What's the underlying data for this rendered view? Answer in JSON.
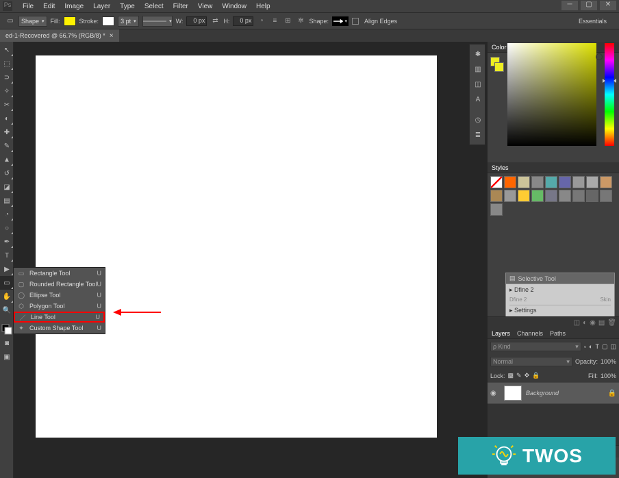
{
  "menubar": {
    "items": [
      "File",
      "Edit",
      "Image",
      "Layer",
      "Type",
      "Select",
      "Filter",
      "View",
      "Window",
      "Help"
    ]
  },
  "options": {
    "shape_mode": "Shape",
    "fill_label": "Fill:",
    "fill_color": "#fff200",
    "stroke_label": "Stroke:",
    "stroke_color": "#ffffff",
    "stroke_width": "3 pt",
    "w_label": "W:",
    "w_value": "0 px",
    "h_label": "H:",
    "h_value": "0 px",
    "shape_label": "Shape:",
    "align_label": "Align Edges",
    "workspace": "Essentials"
  },
  "tab": {
    "title": "ed-1-Recovered @ 66.7% (RGB/8) *"
  },
  "toolbar": {
    "tools": [
      {
        "name": "move-tool",
        "glyph": "↖"
      },
      {
        "name": "marquee-tool",
        "glyph": "▭"
      },
      {
        "name": "lasso-tool",
        "glyph": "⊃"
      },
      {
        "name": "magic-wand-tool",
        "glyph": "✦"
      },
      {
        "name": "crop-tool",
        "glyph": "✂"
      },
      {
        "name": "eyedropper-tool",
        "glyph": "◐"
      },
      {
        "name": "healing-tool",
        "glyph": "✚"
      },
      {
        "name": "brush-tool",
        "glyph": "✎"
      },
      {
        "name": "stamp-tool",
        "glyph": "⊛"
      },
      {
        "name": "history-brush-tool",
        "glyph": "↺"
      },
      {
        "name": "eraser-tool",
        "glyph": "◧"
      },
      {
        "name": "gradient-tool",
        "glyph": "▤"
      },
      {
        "name": "blur-tool",
        "glyph": "◔"
      },
      {
        "name": "dodge-tool",
        "glyph": "○"
      },
      {
        "name": "pen-tool",
        "glyph": "✒"
      },
      {
        "name": "type-tool",
        "glyph": "T"
      },
      {
        "name": "path-selection-tool",
        "glyph": "▶"
      },
      {
        "name": "shape-tool",
        "glyph": "▭",
        "active": true
      },
      {
        "name": "hand-tool",
        "glyph": "✋"
      },
      {
        "name": "zoom-tool",
        "glyph": "🔍"
      }
    ],
    "colors": {
      "fg": "#000000",
      "bg": "#ffffff"
    }
  },
  "flyout": {
    "items": [
      {
        "label": "Rectangle Tool",
        "shortcut": "U",
        "icon": "▭",
        "name": "rectangle-tool"
      },
      {
        "label": "Rounded Rectangle Tool",
        "shortcut": "U",
        "icon": "▢",
        "name": "rounded-rectangle-tool"
      },
      {
        "label": "Ellipse Tool",
        "shortcut": "U",
        "icon": "◯",
        "name": "ellipse-tool"
      },
      {
        "label": "Polygon Tool",
        "shortcut": "U",
        "icon": "⬡",
        "name": "polygon-tool"
      },
      {
        "label": "Line Tool",
        "shortcut": "U",
        "icon": "／",
        "name": "line-tool",
        "highlight": true
      },
      {
        "label": "Custom Shape Tool",
        "shortcut": "U",
        "icon": "✦",
        "name": "custom-shape-tool"
      }
    ]
  },
  "color_panel": {
    "title": "Color",
    "fg": "#eeee22",
    "bg": "#eeee22"
  },
  "styles_panel": {
    "title": "Styles",
    "styles": [
      {
        "c": "#fff",
        "diag": true
      },
      {
        "c": "#ff6600"
      },
      {
        "c": "#ccc49a"
      },
      {
        "c": "#888"
      },
      {
        "c": "#5aa"
      },
      {
        "c": "#66a"
      },
      {
        "c": "#999"
      },
      {
        "c": "#aaa"
      },
      {
        "c": "#cc9966"
      },
      {
        "c": "#aa8855"
      },
      {
        "c": "#999"
      },
      {
        "c": "#ffcc33"
      },
      {
        "c": "#66bb66"
      },
      {
        "c": "#778"
      },
      {
        "c": "#888"
      },
      {
        "c": "#777"
      },
      {
        "c": "#666"
      },
      {
        "c": "#777"
      },
      {
        "c": "#888"
      }
    ]
  },
  "selective": {
    "title": "Selective Tool",
    "group": "Dfine 2",
    "sub1": "Dfine 2",
    "sub2": "Skin",
    "settings": "Settings"
  },
  "layers": {
    "tabs": [
      "Layers",
      "Channels",
      "Paths"
    ],
    "kind": "Kind",
    "blend": "Normal",
    "opacity_label": "Opacity:",
    "opacity": "100%",
    "lock_label": "Lock:",
    "fill_label": "Fill:",
    "fill": "100%",
    "layer_name": "Background"
  },
  "watermark": {
    "text": "TWOS"
  }
}
